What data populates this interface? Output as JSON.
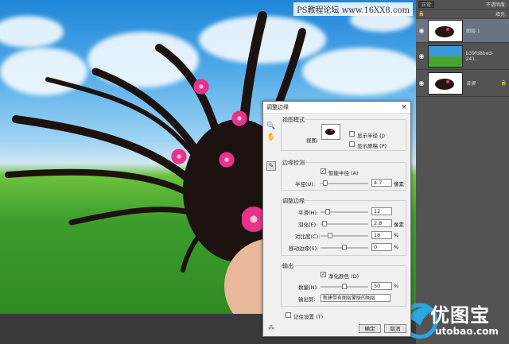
{
  "watermark": "PS教程论坛 www.16XX8.com",
  "layers_panel": {
    "blend_mode": "正常",
    "opacity_label": "不透明度:",
    "fill_label": "填充:",
    "layers": [
      {
        "name": "图层 1",
        "selected": true
      },
      {
        "name": "b39fd8bed-241...",
        "selected": false
      },
      {
        "name": "背景",
        "selected": false,
        "locked": true
      }
    ]
  },
  "logo": {
    "brand": "优图宝",
    "url": "utobao.com"
  },
  "dialog": {
    "title": "调整边缘",
    "close": "×",
    "view_mode": {
      "title": "视图模式",
      "view_label": "视图:",
      "show_radius": "显示半径 (J)",
      "show_original": "显示原稿 (P)"
    },
    "edge_detection": {
      "title": "边缘检测",
      "smart_radius": "智能半径 (A)",
      "radius_label": "半径(U):",
      "radius_value": "4.7",
      "radius_unit": "像素",
      "radius_level": 0.05
    },
    "adjust_edge": {
      "title": "调整边缘",
      "smooth_label": "平滑(H):",
      "smooth_value": "12",
      "smooth_level": 0.12,
      "feather_label": "羽化(E):",
      "feather_value": "2.8",
      "feather_unit": "像素",
      "feather_level": 0.03,
      "contrast_label": "对比度(C):",
      "contrast_value": "16",
      "contrast_unit": "%",
      "contrast_level": 0.16,
      "shift_label": "移动边缘(S):",
      "shift_value": "0",
      "shift_unit": "%",
      "shift_level": 0.5
    },
    "output": {
      "title": "输出",
      "decontaminate": "净化颜色 (D)",
      "amount_label": "数量(N):",
      "amount_value": "50",
      "amount_unit": "%",
      "amount_level": 0.5,
      "output_to_label": "输出到:",
      "output_to_value": "新建带有图层蒙版的图层"
    },
    "remember": "记住设置 (T)",
    "ok": "确定",
    "cancel": "取消"
  }
}
